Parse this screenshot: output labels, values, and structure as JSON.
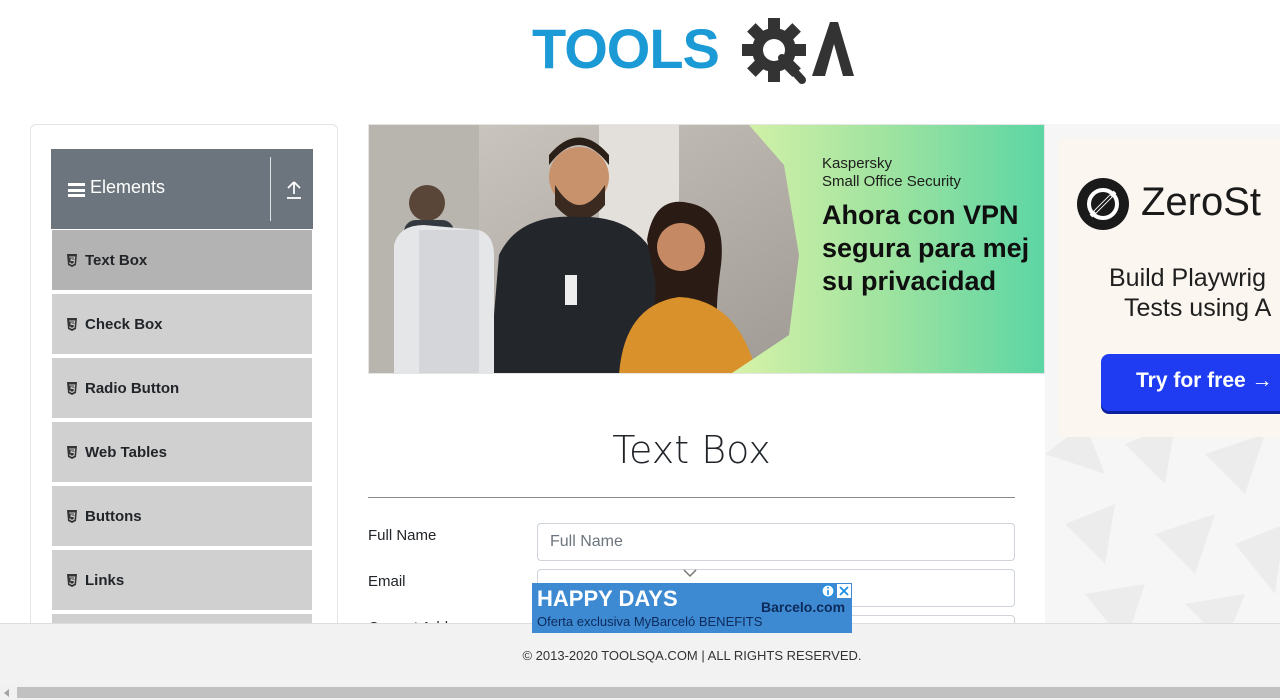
{
  "header": {
    "logo_text_part1": "TOOLS",
    "logo_text_part2": "QA"
  },
  "sidebar": {
    "group_title": "Elements",
    "items": [
      {
        "label": "Text Box",
        "active": true
      },
      {
        "label": "Check Box",
        "active": false
      },
      {
        "label": "Radio Button",
        "active": false
      },
      {
        "label": "Web Tables",
        "active": false
      },
      {
        "label": "Buttons",
        "active": false
      },
      {
        "label": "Links",
        "active": false
      },
      {
        "label": "",
        "active": false
      }
    ]
  },
  "banner_ad": {
    "brand_line1": "Kaspersky",
    "brand_line2": "Small Office Security",
    "headline_line1": "Ahora con VPN",
    "headline_line2": "segura para mej",
    "headline_line3": "su privacidad"
  },
  "side_ad": {
    "brand": "ZeroSt",
    "line1": "Build Playwrig",
    "line2": "Tests using A",
    "cta": "Try for free →"
  },
  "main": {
    "page_title": "Text Box",
    "fields": [
      {
        "label": "Full Name",
        "placeholder": "Full Name",
        "value": ""
      },
      {
        "label": "Email",
        "placeholder": "",
        "value": ""
      },
      {
        "label": "Current Address",
        "placeholder": "",
        "value": ""
      }
    ]
  },
  "bottom_ad": {
    "headline": "HAPPY DAYS",
    "brand": "Barcelo.com",
    "subline": "Oferta exclusiva MyBarceló BENEFITS"
  },
  "footer": {
    "copyright": "© 2013-2020 TOOLSQA.COM | ALL RIGHTS RESERVED."
  },
  "colors": {
    "logo_blue": "#1b9ad6",
    "logo_dark": "#333333",
    "sidebar_header": "#6c757d",
    "menu_item": "#d0d0d0",
    "menu_item_active": "#b3b3b3",
    "cta_blue": "#1f3cf3",
    "bottom_ad_blue": "#3d8ad3"
  }
}
